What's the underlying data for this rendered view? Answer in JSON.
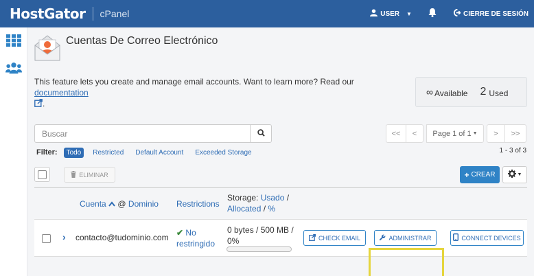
{
  "header": {
    "logo": "HostGator",
    "product": "cPanel",
    "user_label": "USER",
    "logout_label": "CIERRE DE SESIÓN"
  },
  "page": {
    "title": "Cuentas De Correo Electrónico",
    "description": "This feature lets you create and manage email accounts. Want to learn more? Read our",
    "doc_link": "documentation",
    "doc_suffix": "."
  },
  "stats": {
    "available_symbol": "∞",
    "available_label": "Available",
    "used_count": "2",
    "used_label": "Used"
  },
  "search": {
    "placeholder": "Buscar"
  },
  "pagination": {
    "first": "<<",
    "prev": "<",
    "page_label": "Page 1 of 1",
    "next": ">",
    "last": ">>",
    "count": "1 - 3 of 3"
  },
  "filters": {
    "label": "Filter:",
    "items": [
      "Todo",
      "Restricted",
      "Default Account",
      "Exceeded Storage"
    ],
    "active_index": 0
  },
  "toolbar": {
    "delete_label": "ELIMINAR",
    "create_label": "CREAR"
  },
  "table": {
    "headers": {
      "account": "Cuenta",
      "at": "@",
      "domain": "Dominio",
      "restrictions": "Restrictions",
      "storage_prefix": "Storage:",
      "storage_used": "Usado",
      "storage_sep1": "/",
      "storage_allocated": "Allocated",
      "storage_sep2": "/",
      "storage_pct": "%"
    },
    "rows": [
      {
        "email": "contacto@tudominio.com",
        "restriction_line1": "No",
        "restriction_line2": "restringido",
        "storage_line1": "0 bytes / 500 MB /",
        "storage_line2": "0%",
        "usage_fraction": 0,
        "actions": {
          "check_email": "CHECK EMAIL",
          "manage": "ADMINISTRAR",
          "connect": "CONNECT DEVICES"
        }
      }
    ]
  },
  "colors": {
    "header_bg": "#2c5f9e",
    "link": "#2f6db5",
    "primary": "#2f83c6",
    "highlight": "#e5d53c",
    "success": "#3c8a3c"
  }
}
